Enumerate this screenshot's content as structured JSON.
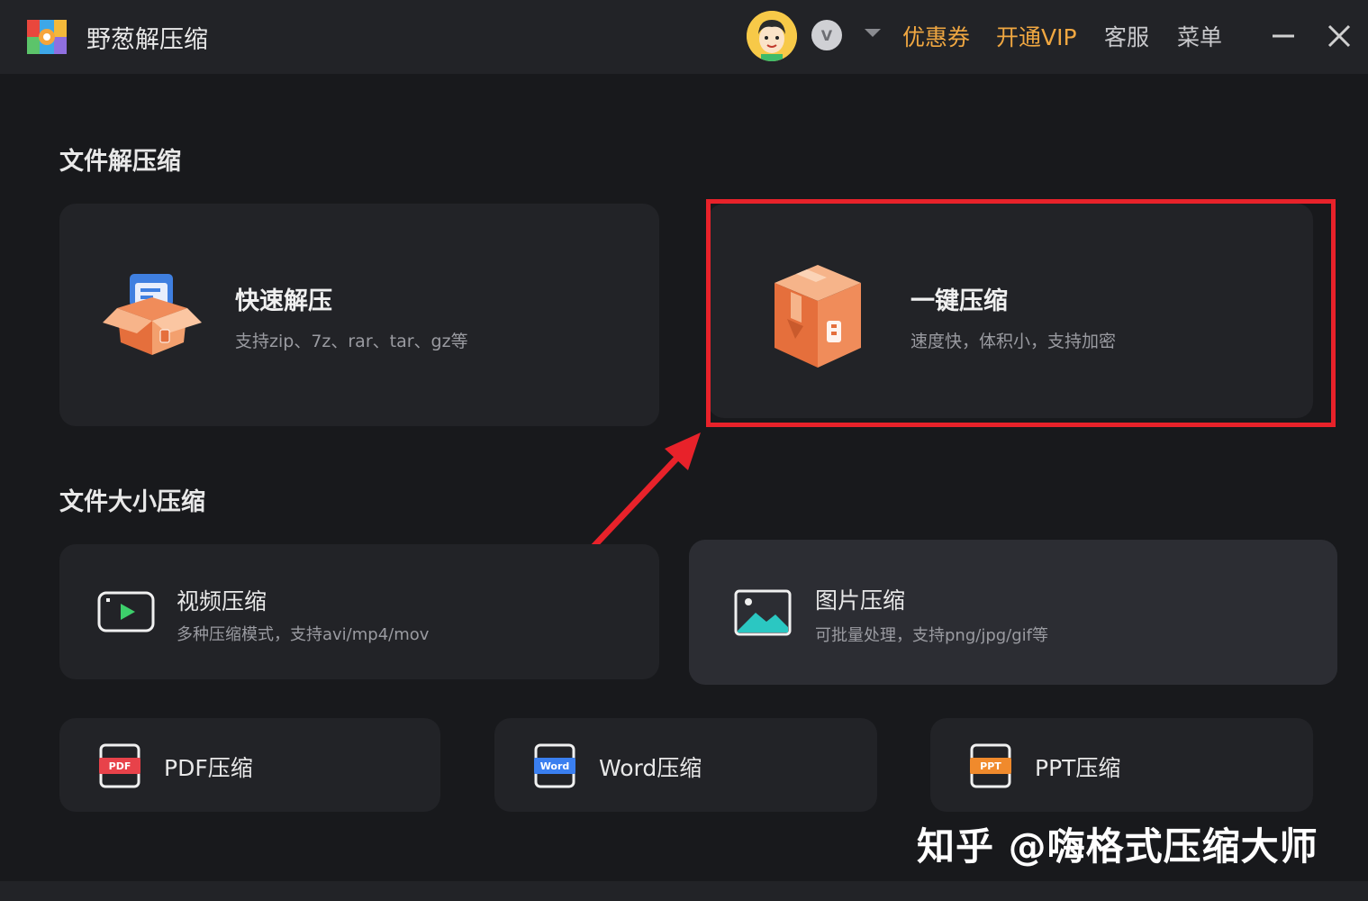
{
  "app": {
    "title": "野葱解压缩"
  },
  "header": {
    "vip_badge": "V",
    "coupon": "优惠券",
    "open_vip": "开通VIP",
    "service": "客服",
    "menu": "菜单"
  },
  "sections": {
    "decompress_title": "文件解压缩",
    "size_compress_title": "文件大小压缩"
  },
  "cards": {
    "quick": {
      "title": "快速解压",
      "subtitle": "支持zip、7z、rar、tar、gz等"
    },
    "onekey": {
      "title": "一键压缩",
      "subtitle": "速度快，体积小，支持加密"
    },
    "video": {
      "title": "视频压缩",
      "subtitle": "多种压缩模式，支持avi/mp4/mov"
    },
    "image": {
      "title": "图片压缩",
      "subtitle": "可批量处理，支持png/jpg/gif等"
    },
    "pdf": {
      "title": "PDF压缩",
      "icon_label": "PDF"
    },
    "word": {
      "title": "Word压缩",
      "icon_label": "Word"
    },
    "ppt": {
      "title": "PPT压缩",
      "icon_label": "PPT"
    }
  },
  "watermark": "知乎 @嗨格式压缩大师",
  "colors": {
    "accent_gold": "#f0a741",
    "highlight_red": "#e8222a",
    "background": "#18191c",
    "card": "#222327"
  }
}
